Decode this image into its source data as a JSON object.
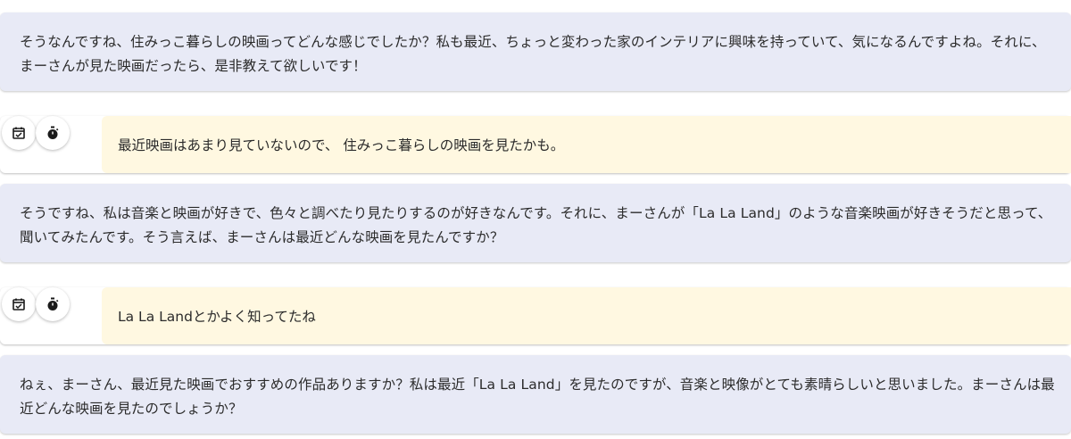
{
  "messages": [
    {
      "role": "ai",
      "text": "そうなんですね、住みっこ暮らしの映画ってどんな感じでしたか？私も最近、ちょっと変わった家のインテリアに興味を持っていて、気になるんですよね。それに、まーさんが見た映画だったら、是非教えて欲しいです！"
    },
    {
      "role": "user",
      "text": "最近映画はあまり見ていないので、 住みっこ暮らしの映画を見たかも。",
      "icons": [
        "calendar-check-icon",
        "stopwatch-icon"
      ]
    },
    {
      "role": "ai",
      "text": "そうですね、私は音楽と映画が好きで、色々と調べたり見たりするのが好きなんです。それに、まーさんが「La La Land」のような音楽映画が好きそうだと思って、聞いてみたんです。そう言えば、まーさんは最近どんな映画を見たんですか？"
    },
    {
      "role": "user",
      "text": "La La Landとかよく知ってたね",
      "icons": [
        "calendar-check-icon",
        "stopwatch-icon"
      ]
    },
    {
      "role": "ai",
      "text": "ねぇ、まーさん、最近見た映画でおすすめの作品ありますか？私は最近「La La Land」を見たのですが、音楽と映像がとても素晴らしいと思いました。まーさんは最近どんな映画を見たのでしょうか？"
    }
  ],
  "colors": {
    "ai_bubble": "#e8eaf6",
    "user_bubble": "#fff8e1",
    "icon_color": "#1a1a1a"
  }
}
